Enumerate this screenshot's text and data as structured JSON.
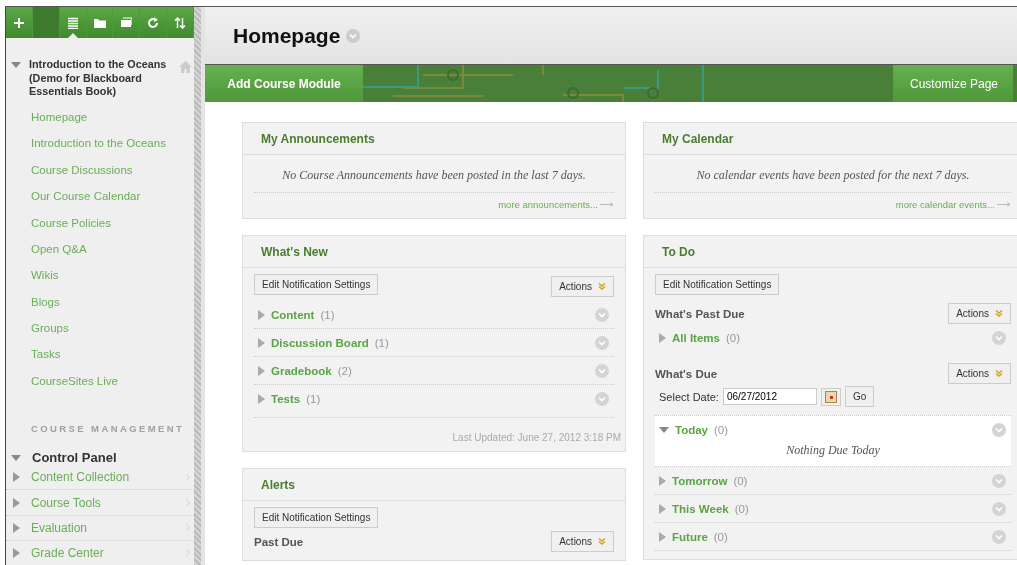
{
  "sidebar": {
    "toolbar": [
      {
        "kind": "add",
        "selected": false
      },
      {
        "kind": "blank",
        "selected": false
      },
      {
        "kind": "list",
        "selected": true
      },
      {
        "kind": "folder",
        "selected": false
      },
      {
        "kind": "window",
        "selected": false
      },
      {
        "kind": "refresh",
        "selected": false
      },
      {
        "kind": "sort",
        "selected": false
      }
    ],
    "course": {
      "title": "Introduction to the Oceans (Demo for Blackboard Essentials Book)",
      "expanded": true,
      "items": [
        "Homepage",
        "Introduction to the Oceans",
        "Course Discussions",
        "Our Course Calendar",
        "Course Policies",
        "Open Q&A",
        "Wikis",
        "Blogs",
        "Groups",
        "Tasks",
        "CourseSites Live"
      ]
    },
    "management_heading": "COURSE MANAGEMENT",
    "control_panel": {
      "title": "Control Panel",
      "expanded": true,
      "items": [
        {
          "label": "Content Collection",
          "expanded": false
        },
        {
          "label": "Course Tools",
          "expanded": false
        },
        {
          "label": "Evaluation",
          "expanded": false
        },
        {
          "label": "Grade Center",
          "expanded": false
        }
      ]
    }
  },
  "page": {
    "title": "Homepage"
  },
  "action_bar": {
    "add_button": "Add Course Module",
    "customize_button": "Customize Page"
  },
  "columns": [
    [
      {
        "kind": "notice",
        "title": "My Announcements",
        "message": "No Course Announcements have been posted in the last 7 days.",
        "link": "more announcements..."
      },
      {
        "kind": "whats_new",
        "title": "What's New",
        "settings_button": "Edit Notification Settings",
        "actions_button": "Actions",
        "groups": [
          {
            "label": "Content",
            "count": "(1)",
            "expanded": false
          },
          {
            "label": "Discussion Board",
            "count": "(1)",
            "expanded": false
          },
          {
            "label": "Gradebook",
            "count": "(2)",
            "expanded": false
          },
          {
            "label": "Tests",
            "count": "(1)",
            "expanded": false
          }
        ],
        "updated": "Last Updated: June 27, 2012 3:18 PM"
      },
      {
        "kind": "alerts",
        "title": "Alerts",
        "settings_button": "Edit Notification Settings",
        "subheading": "Past Due",
        "actions_button": "Actions"
      }
    ],
    [
      {
        "kind": "notice",
        "title": "My Calendar",
        "message": "No calendar events have been posted for the next 7 days.",
        "link": "more calendar events..."
      },
      {
        "kind": "todo",
        "title": "To Do",
        "settings_button": "Edit Notification Settings",
        "past_due": {
          "heading": "What's Past Due",
          "actions_button": "Actions",
          "groups": [
            {
              "label": "All Items",
              "count": "(0)",
              "expanded": false
            }
          ]
        },
        "due": {
          "heading": "What's Due",
          "actions_button": "Actions",
          "date_label": "Select Date:",
          "date_value": "06/27/2012",
          "go_button": "Go",
          "groups": [
            {
              "label": "Today",
              "count": "(0)",
              "expanded": true,
              "empty_text": "Nothing Due Today"
            },
            {
              "label": "Tomorrow",
              "count": "(0)",
              "expanded": false
            },
            {
              "label": "This Week",
              "count": "(0)",
              "expanded": false
            },
            {
              "label": "Future",
              "count": "(0)",
              "expanded": false
            }
          ]
        }
      }
    ]
  ]
}
